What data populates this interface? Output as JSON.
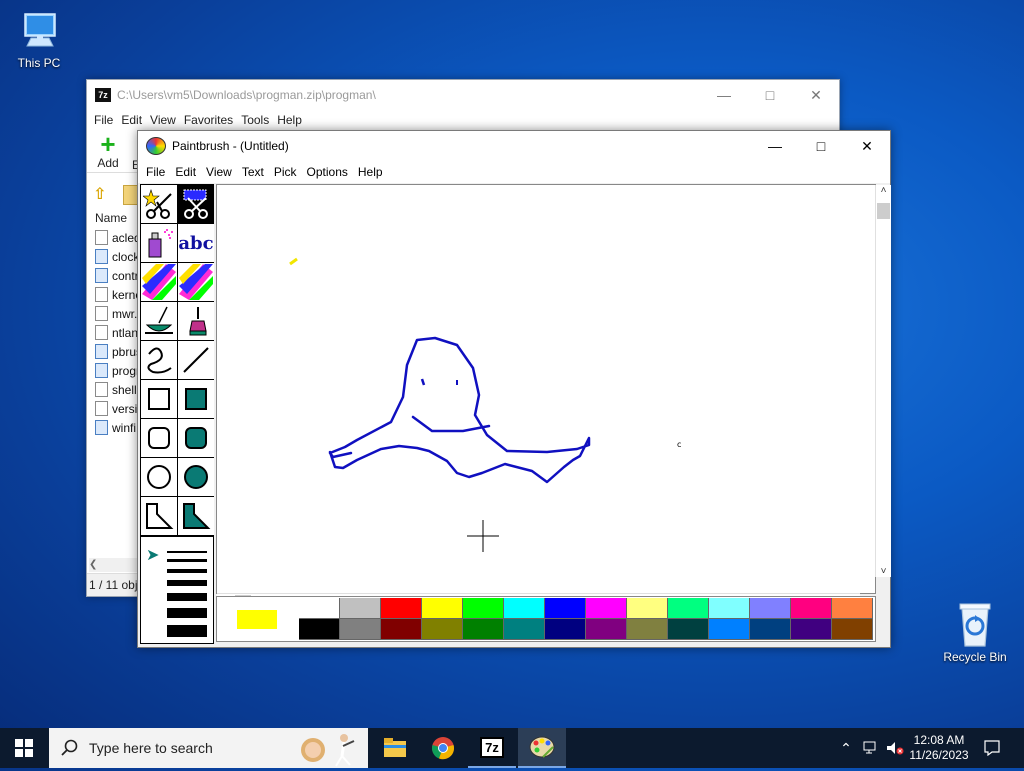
{
  "desktop": {
    "this_pc_label": "This PC",
    "recycle_bin_label": "Recycle Bin"
  },
  "zip_window": {
    "title": "C:\\Users\\vm5\\Downloads\\progman.zip\\progman\\",
    "menu": [
      "File",
      "Edit",
      "View",
      "Favorites",
      "Tools",
      "Help"
    ],
    "toolbar_add": "Add",
    "toolbar_partial": "E",
    "column_name": "Name",
    "files": [
      "acled",
      "clock",
      "contr",
      "kerne",
      "mwr.",
      "ntlan",
      "pbrus",
      "progr",
      "shell",
      "versi",
      "winfi"
    ],
    "status": "1 / 11 obj"
  },
  "paint_window": {
    "title": "Paintbrush - (Untitled)",
    "menu": [
      "File",
      "Edit",
      "View",
      "Text",
      "Pick",
      "Options",
      "Help"
    ],
    "tools": [
      "scissors-select-tool",
      "pick-scissors-tool",
      "airbrush-tool",
      "text-tool",
      "color-eraser-tool",
      "eraser-tool",
      "paint-roller-tool",
      "brush-tool",
      "curve-tool",
      "line-tool",
      "box-tool",
      "filled-box-tool",
      "rounded-box-tool",
      "filled-rounded-box-tool",
      "circle-tool",
      "filled-circle-tool",
      "polygon-tool",
      "filled-polygon-tool"
    ],
    "text_tool_glyph": "abc",
    "current_foreground": "#ffff00",
    "current_background": "#ffffff",
    "palette_top": [
      "#ffffff",
      "#c0c0c0",
      "#ff0000",
      "#ffff00",
      "#00ff00",
      "#00ffff",
      "#0000ff",
      "#ff00ff",
      "#ffff80",
      "#00ff80",
      "#80ffff",
      "#8080ff",
      "#ff0080",
      "#ff8040"
    ],
    "palette_bottom": [
      "#000000",
      "#808080",
      "#800000",
      "#808000",
      "#008000",
      "#008080",
      "#000080",
      "#800080",
      "#808040",
      "#004040",
      "#0080ff",
      "#004080",
      "#400080",
      "#804000"
    ],
    "drawing_color": "#1010c0"
  },
  "taskbar": {
    "search_placeholder": "Type here to search",
    "time": "12:08 AM",
    "date": "11/26/2023"
  }
}
